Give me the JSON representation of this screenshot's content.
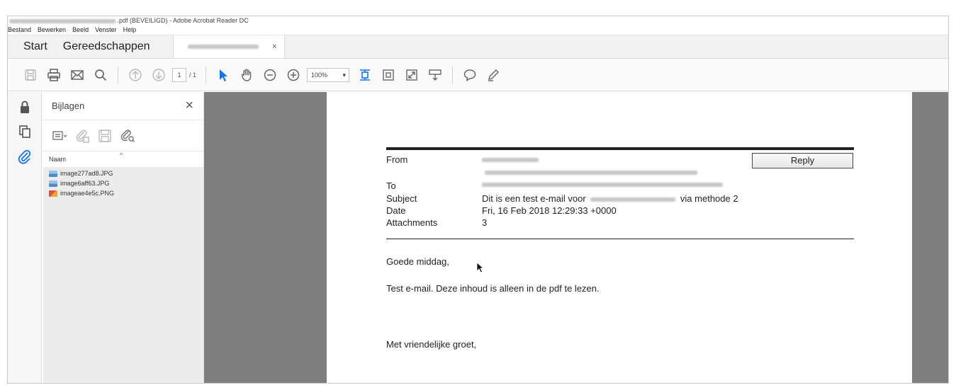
{
  "window": {
    "title_suffix": ".pdf (BEVEILIGD) - Adobe Acrobat Reader DC",
    "menu": [
      "Bestand",
      "Bewerken",
      "Beeld",
      "Venster",
      "Help"
    ]
  },
  "tabs": {
    "start": "Start",
    "tools": "Gereedschappen",
    "doc_close": "×"
  },
  "toolbar": {
    "page_current": "1",
    "page_total": "/ 1",
    "zoom": "100%",
    "zoom_caret": "▾"
  },
  "panel": {
    "title": "Bijlagen",
    "close": "×",
    "column_name": "Naam",
    "sort_caret": "^",
    "files": [
      {
        "name": "image277ad8.JPG",
        "type": "jpg"
      },
      {
        "name": "image6aff63.JPG",
        "type": "jpg"
      },
      {
        "name": "imageae4e5c.PNG",
        "type": "png"
      }
    ]
  },
  "email": {
    "from_label": "From",
    "to_label": "To",
    "subject_label": "Subject",
    "subject_prefix": "Dit is een test e-mail voor",
    "subject_suffix": "via methode 2",
    "date_label": "Date",
    "date_value": "Fri, 16 Feb 2018 12:29:33 +0000",
    "attachments_label": "Attachments",
    "attachments_value": "3",
    "reply_label": "Reply",
    "greeting": "Goede middag,",
    "body": "Test e-mail. Deze inhoud is alleen in de pdf te lezen.",
    "closing": "Met vriendelijke groet,"
  },
  "colors": {
    "accent": "#1473e6",
    "doc_background": "#7f7f7f"
  }
}
